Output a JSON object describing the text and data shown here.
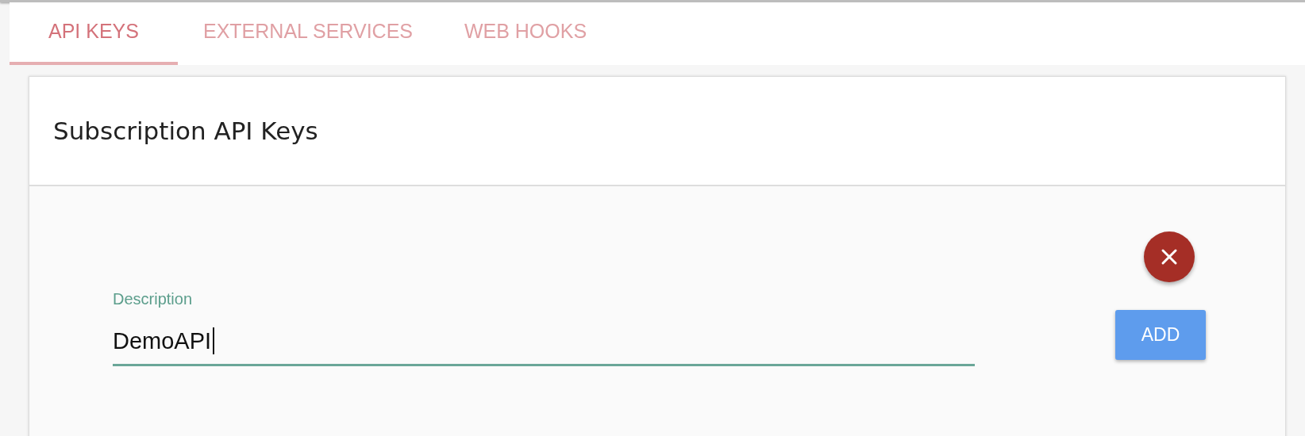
{
  "tabs": [
    {
      "label": "API KEYS",
      "selected": true
    },
    {
      "label": "EXTERNAL SERVICES",
      "selected": false
    },
    {
      "label": "WEB HOOKS",
      "selected": false
    }
  ],
  "card": {
    "title": "Subscription API Keys",
    "form": {
      "label": "Description",
      "value": "DemoAPI",
      "add_button": "ADD"
    }
  }
}
